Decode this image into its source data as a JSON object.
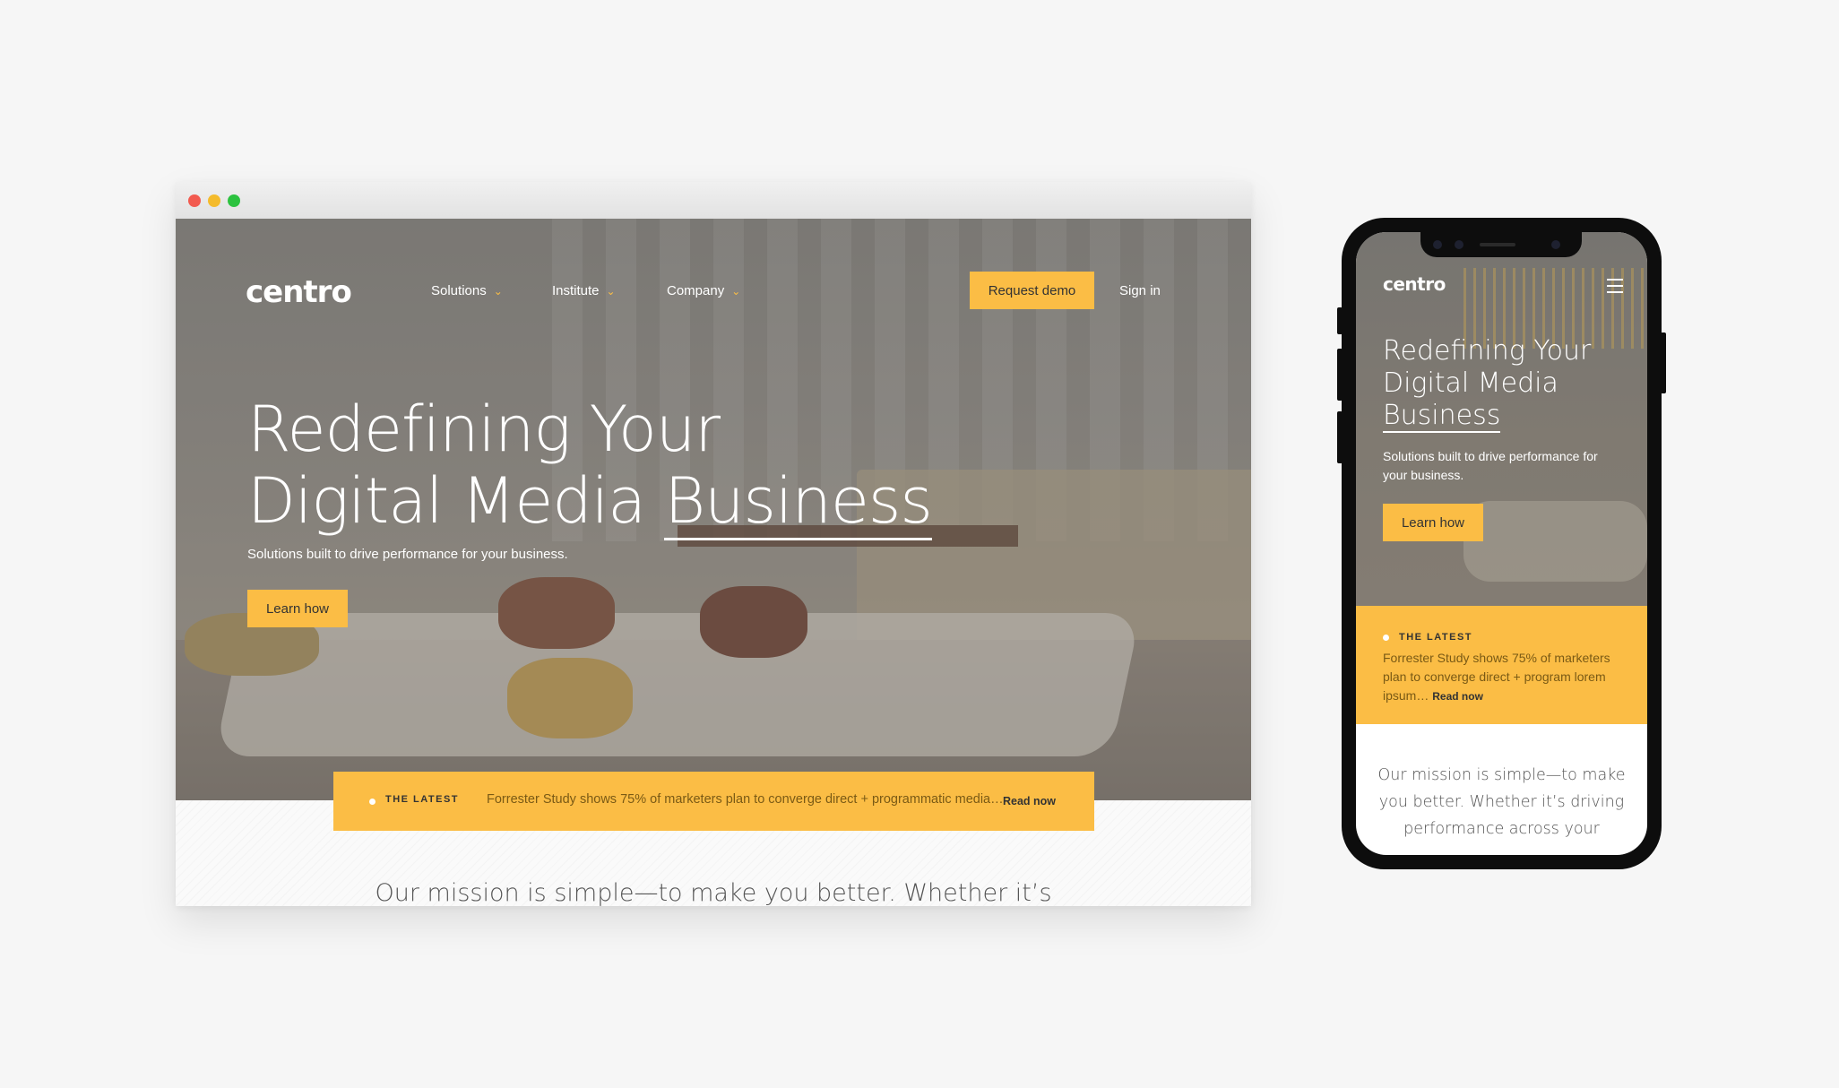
{
  "desktop": {
    "logo": "centro",
    "nav": {
      "solutions": "Solutions",
      "institute": "Institute",
      "company": "Company",
      "request_demo": "Request demo",
      "sign_in": "Sign in"
    },
    "hero": {
      "title_line1": "Redefining Your",
      "title_line2_a": "Digital Media ",
      "title_line2_b": "Business",
      "subtitle": "Solutions built to drive performance for your business.",
      "cta": "Learn how"
    },
    "latest": {
      "tag": "THE LATEST",
      "text": "Forrester Study shows 75% of marketers plan to converge direct + programmatic media…",
      "link": "Read now"
    },
    "mission": "Our mission is simple—to make you better. Whether it’s"
  },
  "mobile": {
    "logo": "centro",
    "hero": {
      "title_line1": "Redefining Your",
      "title_line2": "Digital Media",
      "title_line3": "Business",
      "subtitle": "Solutions built to drive performance for your business.",
      "cta": "Learn how"
    },
    "latest": {
      "tag": "THE LATEST",
      "text": "Forrester Study shows 75% of marketers plan to converge direct + program lorem ipsum… ",
      "link": "Read now"
    },
    "mission": "Our mission is simple—to make you better. Whether it’s driving performance across your"
  },
  "colors": {
    "accent": "#fbbd45",
    "background": "#f6f6f6",
    "phone_body": "#0d0d0d"
  },
  "icons": [
    "close-dot-icon",
    "minimize-dot-icon",
    "maximize-dot-icon",
    "chevron-down-icon",
    "hamburger-menu-icon"
  ]
}
